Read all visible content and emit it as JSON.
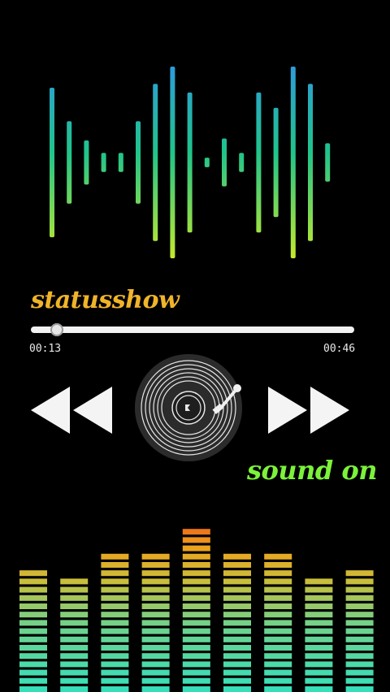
{
  "player": {
    "track_name": "statusshow",
    "elapsed": "00:13",
    "total": "00:46",
    "progress_fraction": 0.08,
    "sound_status": "sound on"
  },
  "icons": {
    "rewind": "rewind-icon",
    "forward": "fast-forward-icon",
    "record": "vinyl-record-icon",
    "tonearm": "tonearm-icon"
  },
  "colors": {
    "title": "#f0b429",
    "status": "#7cf23a",
    "wave_gradient_top": "#2d9cdb",
    "wave_gradient_bottom": "#b7e635",
    "eq_top": "#e8521a",
    "eq_mid": "#f0a01a",
    "eq_bottom": "#2fe0c0"
  },
  "waveform": {
    "levels": [
      0.78,
      0.43,
      0.23,
      0.1,
      0.1,
      0.43,
      0.82,
      1.0,
      0.73,
      0.05,
      0.25,
      0.1,
      0.73,
      0.57,
      1.0,
      0.82,
      0.2
    ]
  },
  "equalizer": {
    "levels": [
      0.72,
      0.67,
      0.83,
      0.83,
      0.94,
      0.83,
      0.79,
      0.67,
      0.72
    ]
  }
}
